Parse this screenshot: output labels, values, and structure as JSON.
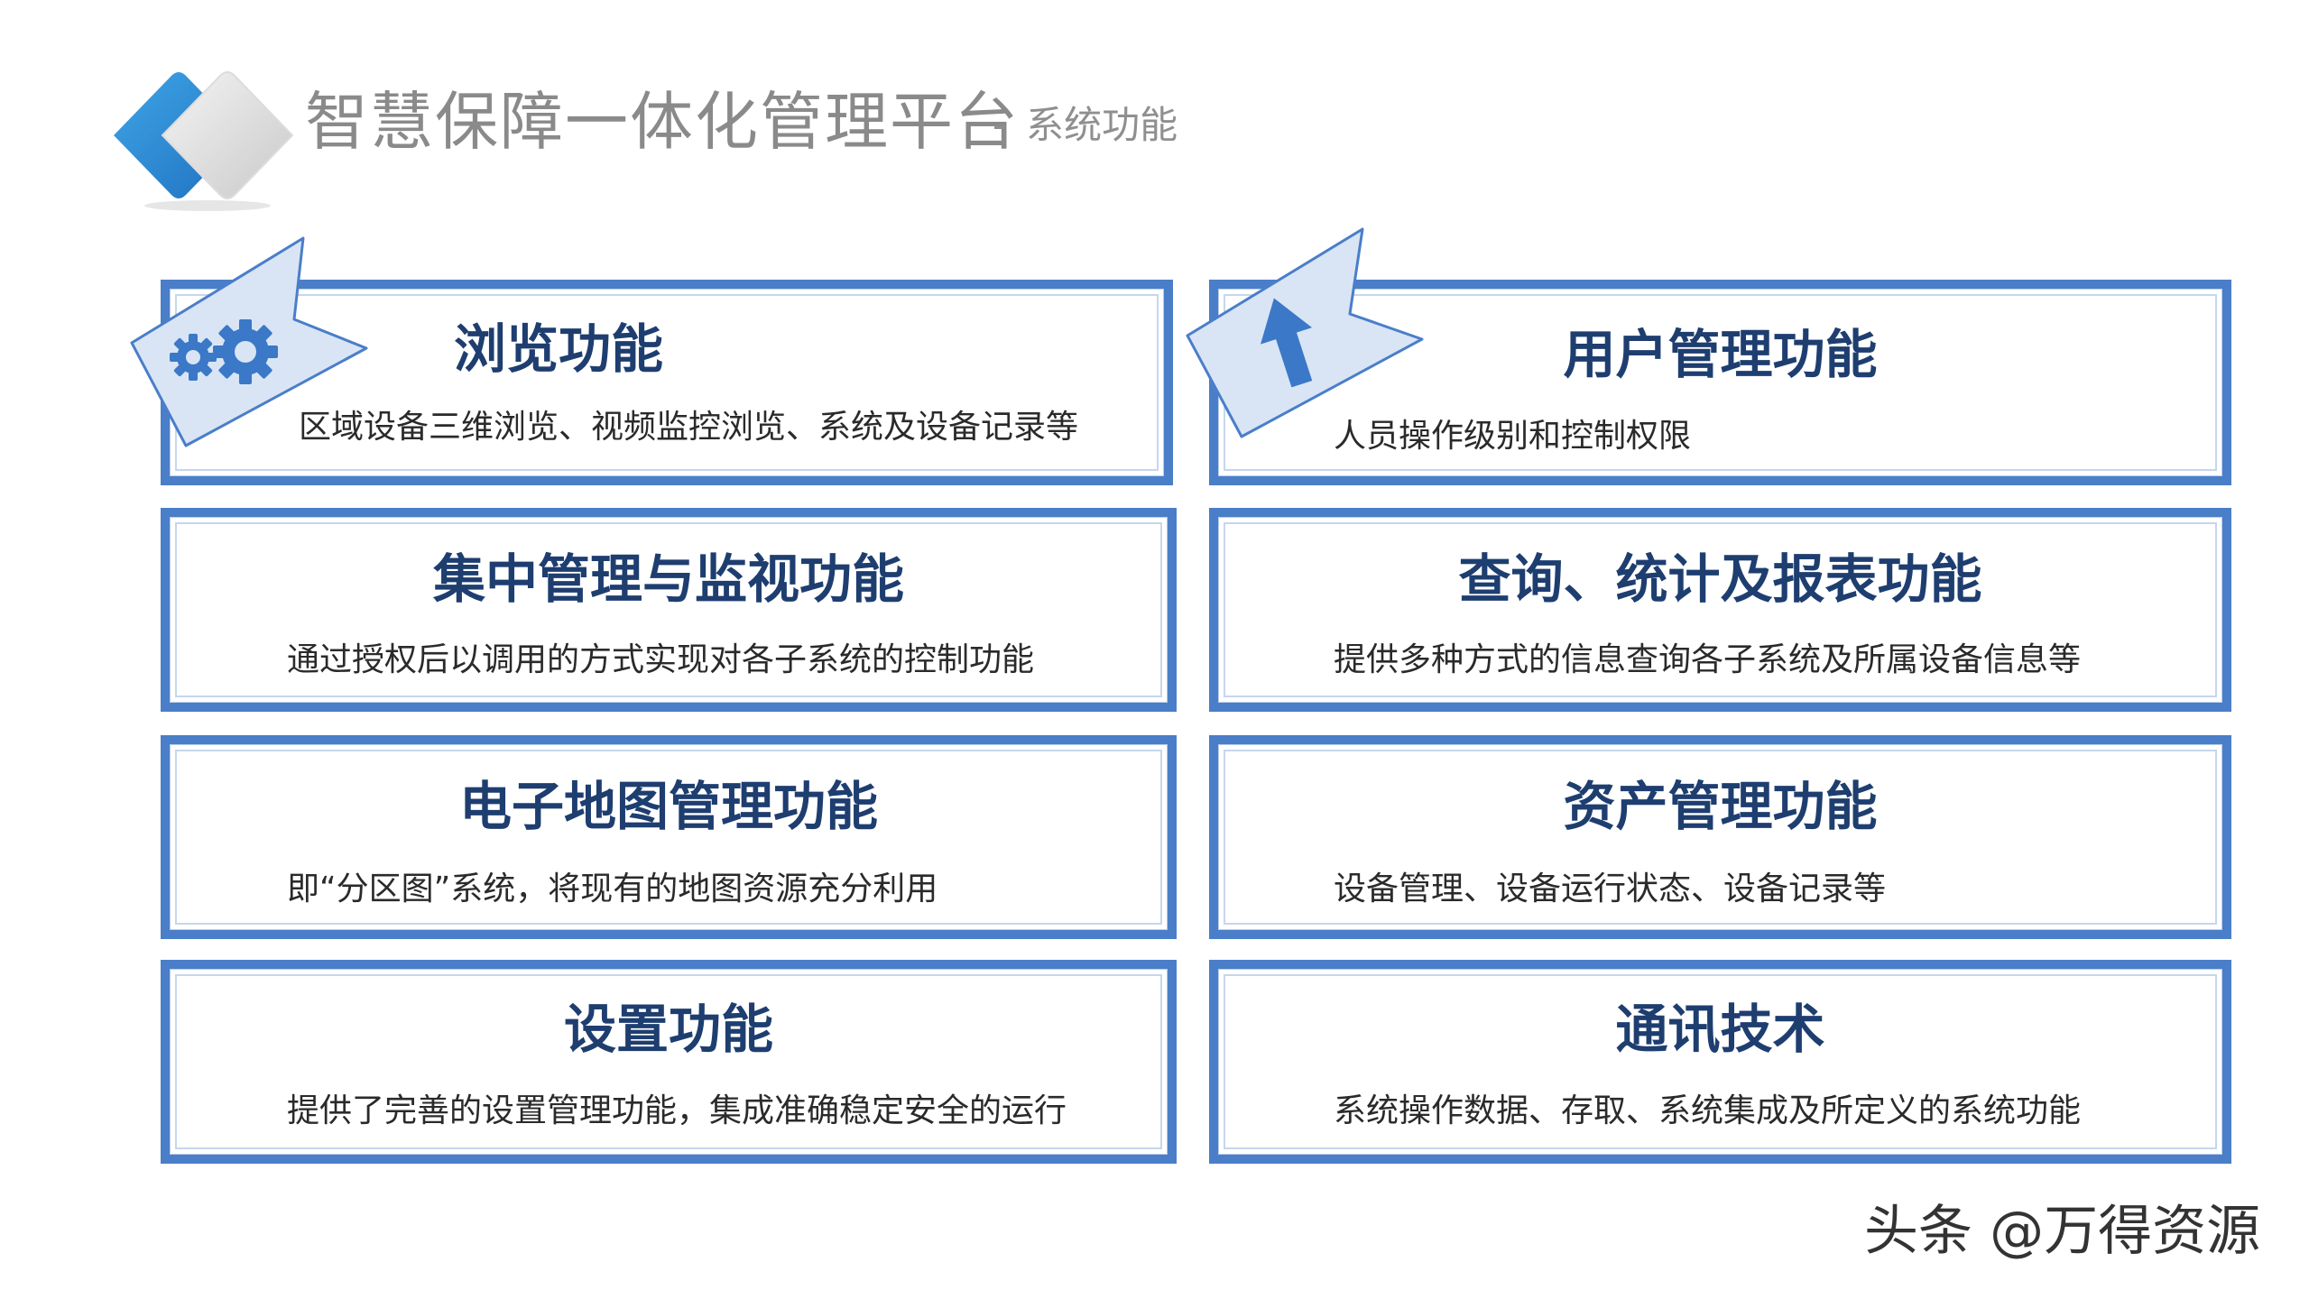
{
  "header": {
    "title": "智慧保障一体化管理平台",
    "subtitle_dash": "-",
    "subtitle": "系统功能"
  },
  "cards": [
    {
      "title": "浏览功能",
      "desc": "区域设备三维浏览、视频监控浏览、系统及设备记录等",
      "icon": "gears-icon"
    },
    {
      "title": "用户管理功能",
      "desc": "人员操作级别和控制权限",
      "icon": "cursor-arrow-icon"
    },
    {
      "title": "集中管理与监视功能",
      "desc": "通过授权后以调用的方式实现对各子系统的控制功能"
    },
    {
      "title": "查询、统计及报表功能",
      "desc": "提供多种方式的信息查询各子系统及所属设备信息等"
    },
    {
      "title": "电子地图管理功能",
      "desc": "即“分区图”系统，将现有的地图资源充分利用"
    },
    {
      "title": "资产管理功能",
      "desc": "设备管理、设备运行状态、设备记录等"
    },
    {
      "title": "设置功能",
      "desc": "提供了完善的设置管理功能，集成准确稳定安全的运行"
    },
    {
      "title": "通讯技术",
      "desc": "系统操作数据、存取、系统集成及所定义的系统功能"
    }
  ],
  "watermark": "头条 @万得资源",
  "colors": {
    "border": "#4a7ec9",
    "title": "#1e3e70",
    "accent": "#3a9ad9"
  }
}
